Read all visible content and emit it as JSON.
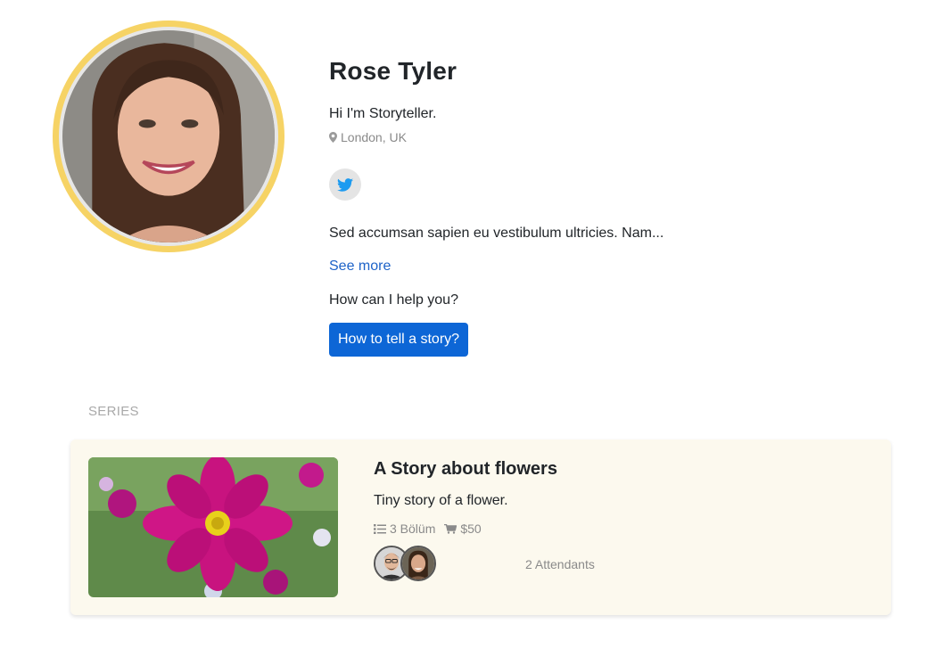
{
  "profile": {
    "name": "Rose Tyler",
    "bio": "Hi I'm Storyteller.",
    "location": "London, UK",
    "about": "Sed accumsan sapien eu vestibulum ultricies. Nam...",
    "see_more": "See more",
    "help_question": "How can I help you?",
    "help_button": "How to tell a story?",
    "social": [
      "twitter-icon"
    ],
    "colors": {
      "avatar_ring": "#f6d365",
      "primary": "#0d66d6",
      "link": "#1e63c8",
      "twitter": "#1d9bf0"
    }
  },
  "series": {
    "heading": "SERIES",
    "items": [
      {
        "title": "A Story about flowers",
        "description": "Tiny story of a flower.",
        "episodes": "3 Bölüm",
        "price": "$50",
        "attendants": "2 Attendants",
        "card_bg": "#fcf9ee"
      }
    ]
  }
}
